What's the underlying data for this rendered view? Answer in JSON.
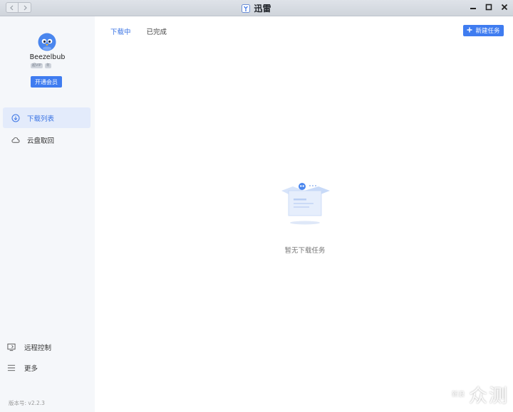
{
  "window": {
    "title": "迅雷"
  },
  "icons": {
    "back": "chevron-left-icon",
    "forward": "chevron-right-icon",
    "app": "xunlei-logo-icon",
    "minimize": "minimize-icon",
    "maximize": "maximize-icon",
    "close": "close-icon"
  },
  "user": {
    "name": "Beezelbub",
    "tags": [
      "超VIP",
      "年"
    ],
    "vip_button": "开通会员"
  },
  "sidebar": {
    "items": [
      {
        "label": "下载列表",
        "icon": "download-circle-icon",
        "active": true
      },
      {
        "label": "云盘取回",
        "icon": "cloud-icon",
        "active": false
      }
    ],
    "bottom": [
      {
        "label": "远程控制",
        "icon": "remote-monitor-icon"
      },
      {
        "label": "更多",
        "icon": "hamburger-menu-icon"
      }
    ],
    "version_label": "版本号:",
    "version": "v2.2.3"
  },
  "main": {
    "tabs": [
      {
        "label": "下载中",
        "active": true
      },
      {
        "label": "已完成",
        "active": false
      }
    ],
    "new_task_label": "新建任务",
    "empty_text": "暂无下载任务"
  },
  "watermark": {
    "small": "新浪",
    "big": "众测"
  },
  "colors": {
    "accent": "#3f7cf0",
    "sidebar_bg": "#f5f7fa",
    "active_bg": "#e3ebfb"
  }
}
